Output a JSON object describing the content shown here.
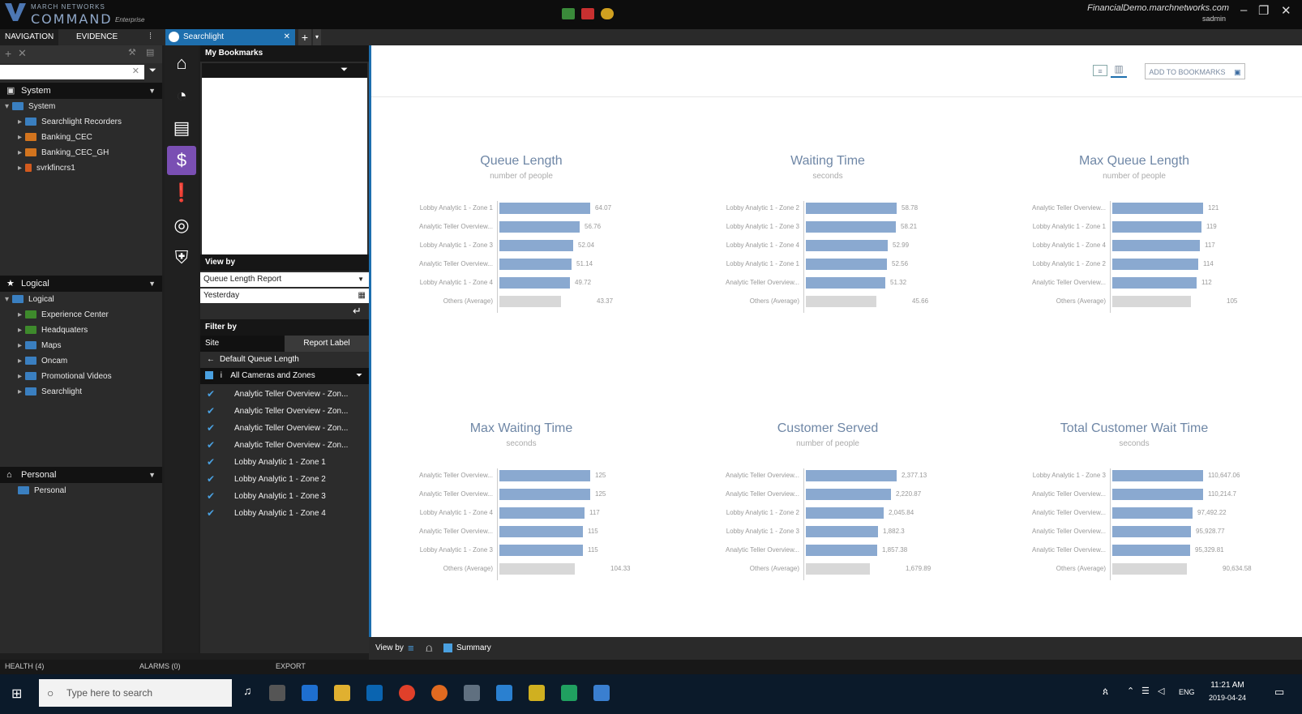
{
  "app": {
    "brand_top": "MARCH NETWORKS",
    "brand_main": "COMMAND",
    "brand_edition": "Enterprise",
    "server": "FinancialDemo.marchnetworks.com",
    "user": "sadmin"
  },
  "nav": {
    "tabs": [
      "NAVIGATION",
      "EVIDENCE"
    ],
    "system_header": "System",
    "system_items": [
      "System",
      "Searchlight Recorders",
      "Banking_CEC",
      "Banking_CEC_GH",
      "svrkfincrs1"
    ],
    "logical_header": "Logical",
    "logical_items": [
      "Logical",
      "Experience Center",
      "Headquaters",
      "Maps",
      "Oncam",
      "Promotional Videos",
      "Searchlight"
    ],
    "personal_header": "Personal",
    "personal_items": [
      "Personal"
    ]
  },
  "tabs": {
    "active": "Searchlight"
  },
  "mid": {
    "bookmarks_header": "My Bookmarks",
    "view_by_header": "View by",
    "report": "Queue Length Report",
    "period": "Yesterday",
    "filter_header": "Filter by",
    "filter_tabs": [
      "Site",
      "Report Label"
    ],
    "default_link": "Default Queue Length",
    "all_cameras": "All Cameras and Zones",
    "cameras": [
      "Analytic Teller Overview - Zon...",
      "Analytic Teller Overview - Zon...",
      "Analytic Teller Overview - Zon...",
      "Analytic Teller Overview - Zon...",
      "Lobby Analytic 1 - Zone 1",
      "Lobby Analytic 1 - Zone 2",
      "Lobby Analytic 1 - Zone 3",
      "Lobby Analytic 1 - Zone 4"
    ]
  },
  "main": {
    "add_to_bookmarks": "ADD TO BOOKMARKS",
    "bottom_view_by": "View by",
    "summary_label": "Summary"
  },
  "chart_data": [
    {
      "type": "bar",
      "title": "Queue Length",
      "subtitle": "number of people",
      "categories": [
        "Lobby Analytic 1 - Zone 1",
        "Analytic Teller Overview...",
        "Lobby Analytic 1 - Zone 3",
        "Analytic Teller Overview...",
        "Lobby Analytic 1 - Zone 4",
        "Others (Average)"
      ],
      "labels": [
        "64.07",
        "56.76",
        "52.04",
        "51.14",
        "49.72",
        "43.37"
      ],
      "values": [
        64.07,
        56.76,
        52.04,
        51.14,
        49.72,
        43.37
      ]
    },
    {
      "type": "bar",
      "title": "Waiting Time",
      "subtitle": "seconds",
      "categories": [
        "Lobby Analytic 1 - Zone 2",
        "Lobby Analytic 1 - Zone 3",
        "Lobby Analytic 1 - Zone 4",
        "Lobby Analytic 1 - Zone 1",
        "Analytic Teller Overview...",
        "Others (Average)"
      ],
      "labels": [
        "58.78",
        "58.21",
        "52.99",
        "52.56",
        "51.32",
        "45.66"
      ],
      "values": [
        58.78,
        58.21,
        52.99,
        52.56,
        51.32,
        45.66
      ]
    },
    {
      "type": "bar",
      "title": "Max Queue Length",
      "subtitle": "number of people",
      "categories": [
        "Analytic Teller Overview...",
        "Lobby Analytic 1 - Zone 1",
        "Lobby Analytic 1 - Zone 4",
        "Lobby Analytic 1 - Zone 2",
        "Analytic Teller Overview...",
        "Others (Average)"
      ],
      "labels": [
        "121",
        "119",
        "117",
        "114",
        "112",
        "105"
      ],
      "values": [
        121,
        119,
        117,
        114,
        112,
        105
      ]
    },
    {
      "type": "bar",
      "title": "Max Waiting Time",
      "subtitle": "seconds",
      "categories": [
        "Analytic Teller Overview...",
        "Analytic Teller Overview...",
        "Lobby Analytic 1 - Zone 4",
        "Analytic Teller Overview...",
        "Lobby Analytic 1 - Zone 3",
        "Others (Average)"
      ],
      "labels": [
        "125",
        "125",
        "117",
        "115",
        "115",
        "104.33"
      ],
      "values": [
        125,
        125,
        117,
        115,
        115,
        104.33
      ]
    },
    {
      "type": "bar",
      "title": "Customer Served",
      "subtitle": "number of people",
      "categories": [
        "Analytic Teller Overview...",
        "Analytic Teller Overview...",
        "Lobby Analytic 1 - Zone 2",
        "Lobby Analytic 1 - Zone 3",
        "Analytic Teller Overview...",
        "Others (Average)"
      ],
      "labels": [
        "2,377.13",
        "2,220.87",
        "2,045.84",
        "1,882.3",
        "1,857.38",
        "1,679.89"
      ],
      "values": [
        2377.13,
        2220.87,
        2045.84,
        1882.3,
        1857.38,
        1679.89
      ]
    },
    {
      "type": "bar",
      "title": "Total Customer Wait Time",
      "subtitle": "seconds",
      "categories": [
        "Lobby Analytic 1 - Zone 3",
        "Analytic Teller Overview...",
        "Analytic Teller Overview...",
        "Analytic Teller Overview...",
        "Analytic Teller Overview...",
        "Others (Average)"
      ],
      "labels": [
        "110,647.06",
        "110,214.7",
        "97,492.22",
        "95,928.77",
        "95,329.81",
        "90,634.58"
      ],
      "values": [
        110647.06,
        110214.7,
        97492.22,
        95928.77,
        95329.81,
        90634.58
      ]
    }
  ],
  "status": {
    "health": "HEALTH (4)",
    "alarms": "ALARMS (0)",
    "export": "EXPORT"
  },
  "taskbar": {
    "search": "Type here to search",
    "time": "11:21 AM",
    "date": "2019-04-24",
    "lang": "ENG"
  },
  "colors": {
    "bar": "#8aa9d0",
    "avg_bar": "#d8d8d8",
    "accent": "#1e6fae",
    "title": "#6f87a6"
  }
}
